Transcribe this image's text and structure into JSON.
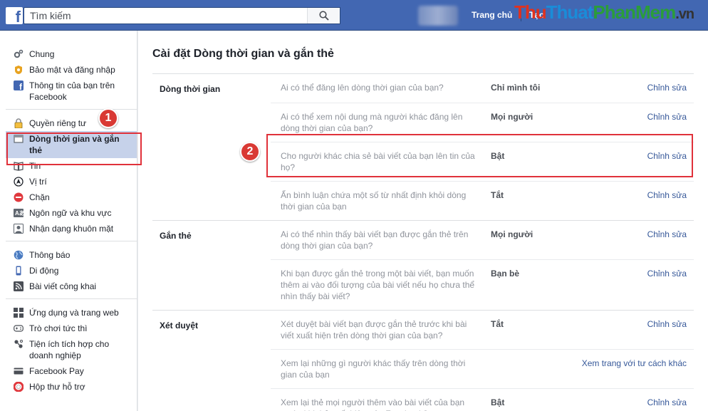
{
  "topbar": {
    "search_placeholder": "Tìm kiếm",
    "home_label": "Trang chủ",
    "create_label": "Tạo",
    "watermark": [
      "Thu",
      "Thuat",
      "PhanMem",
      ".vn"
    ]
  },
  "sidebar": {
    "groups": [
      [
        {
          "label": "Chung",
          "icon": "gears-icon"
        },
        {
          "label": "Bảo mật và đăng nhập",
          "icon": "security-badge-icon"
        },
        {
          "label": "Thông tin của bạn trên Facebook",
          "icon": "facebook-icon"
        }
      ],
      [
        {
          "label": "Quyền riêng tư",
          "icon": "lock-icon"
        },
        {
          "label": "Dòng thời gian và gắn thẻ",
          "icon": "timeline-icon",
          "active": true
        },
        {
          "label": "Tin",
          "icon": "book-icon"
        },
        {
          "label": "Vị trí",
          "icon": "location-icon"
        },
        {
          "label": "Chặn",
          "icon": "block-icon"
        },
        {
          "label": "Ngôn ngữ và khu vực",
          "icon": "language-icon"
        },
        {
          "label": "Nhận dạng khuôn mặt",
          "icon": "face-recognition-icon"
        }
      ],
      [
        {
          "label": "Thông báo",
          "icon": "globe-icon"
        },
        {
          "label": "Di động",
          "icon": "mobile-icon"
        },
        {
          "label": "Bài viết công khai",
          "icon": "rss-icon"
        }
      ],
      [
        {
          "label": "Ứng dụng và trang web",
          "icon": "apps-icon"
        },
        {
          "label": "Trò chơi tức thì",
          "icon": "gamepad-icon"
        },
        {
          "label": "Tiện ích tích hợp cho doanh nghiệp",
          "icon": "business-integration-icon"
        },
        {
          "label": "Facebook Pay",
          "icon": "card-icon"
        },
        {
          "label": "Hộp thư hỗ trợ",
          "icon": "lifebuoy-icon"
        }
      ]
    ]
  },
  "annotations": {
    "badge1": "1",
    "badge2": "2"
  },
  "main": {
    "title": "Cài đặt Dòng thời gian và gắn thẻ",
    "sections": [
      {
        "label": "Dòng thời gian",
        "rows": [
          {
            "question": "Ai có thể đăng lên dòng thời gian của bạn?",
            "value": "Chỉ mình tôi",
            "action": "Chỉnh sửa"
          },
          {
            "question": "Ai có thể xem nội dung mà người khác đăng lên dòng thời gian của bạn?",
            "value": "Mọi người",
            "action": "Chỉnh sửa"
          },
          {
            "question": "Cho người khác chia sẻ bài viết của bạn lên tin của họ?",
            "value": "Bật",
            "action": "Chỉnh sửa"
          },
          {
            "question": "Ẩn bình luận chứa một số từ nhất định khỏi dòng thời gian của bạn",
            "value": "Tắt",
            "action": "Chỉnh sửa"
          }
        ]
      },
      {
        "label": "Gắn thẻ",
        "rows": [
          {
            "question": "Ai có thể nhìn thấy bài viết bạn được gắn thẻ trên dòng thời gian của bạn?",
            "value": "Mọi người",
            "action": "Chỉnh sửa"
          },
          {
            "question": "Khi bạn được gắn thẻ trong một bài viết, bạn muốn thêm ai vào đối tượng của bài viết nếu họ chưa thể nhìn thấy bài viết?",
            "value": "Bạn bè",
            "action": "Chỉnh sửa"
          }
        ]
      },
      {
        "label": "Xét duyệt",
        "rows": [
          {
            "question": "Xét duyệt bài viết bạn được gắn thẻ trước khi bài viết xuất hiện trên dòng thời gian của bạn?",
            "value": "Tắt",
            "action": "Chỉnh sửa"
          },
          {
            "question": "Xem lại những gì người khác thấy trên dòng thời gian của bạn",
            "value": "",
            "action": "Xem trang với tư cách khác"
          },
          {
            "question": "Xem lại thẻ mọi người thêm vào bài viết của bạn trước khi thẻ xuất hiện trên Facebook?",
            "value": "Bật",
            "action": "Chỉnh sửa"
          }
        ]
      }
    ]
  }
}
